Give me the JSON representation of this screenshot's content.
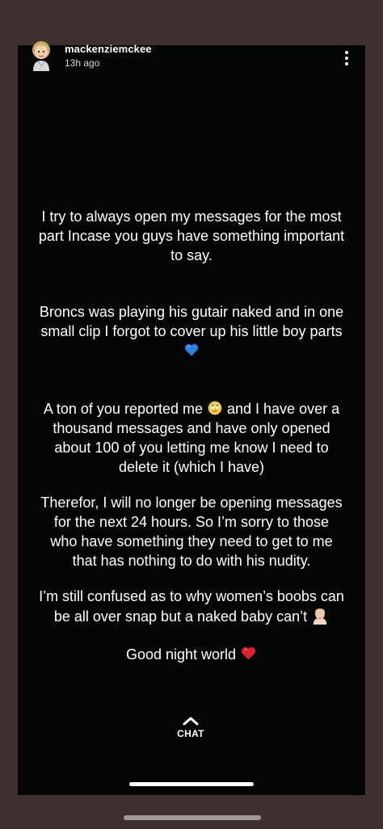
{
  "header": {
    "username": "mackenziemckee",
    "time_ago": "13h ago"
  },
  "icons": {
    "avatar": "bitmoji-avatar",
    "menu": "more-vertical-icon",
    "chat_chevron": "chevron-up-icon",
    "blue_heart": "blue-heart-emoji",
    "rolling_eyes": "rolling-eyes-emoji",
    "facepalm": "woman-facepalming-emoji",
    "red_heart": "red-heart-emoji"
  },
  "story": {
    "line1": "I try to always open my messages for the most",
    "line2": "part Incase you guys have something important",
    "line3": "to say.",
    "line4": "Broncs was playing his gutair naked and  in one",
    "line5": "small clip I forgot to cover up his little boy parts",
    "line6_emoji": "💙",
    "line7a": "A ton of you reported me ",
    "line7_emoji": "🙄",
    "line7b": " and I have over a",
    "line8": "thousand messages and have only opened",
    "line9": "about 100 of you letting me know I need to",
    "line10": "delete it (which I have)",
    "line11": "Therefor, I will no longer be opening messages",
    "line12": "for the next 24 hours. So I’m sorry to those",
    "line13": "who have something they need to get to me",
    "line14": "that has nothing to do with his nudity.",
    "line15": "I’m still confused as to why women’s boobs can",
    "line16": "be all over snap but a naked baby can’t ",
    "line16_emoji": "🤦🏼‍♀️",
    "line17": "Good night world ",
    "line17_emoji": "❤️"
  },
  "chat": {
    "label": "CHAT"
  },
  "colors": {
    "page_bg": "#3e302c",
    "story_bg": "#050505",
    "text": "#ffffff",
    "blue_heart": "#2f7fe0",
    "red_heart": "#e0202e"
  }
}
